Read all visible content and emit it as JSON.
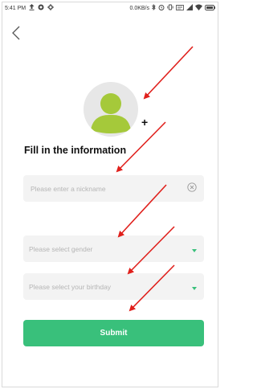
{
  "status_bar": {
    "time": "5:41 PM",
    "left_icons": [
      "upload-icon",
      "notification-icon",
      "settings-icon"
    ],
    "network_speed": "0.0KB/s",
    "right_icons": [
      "bluetooth-icon",
      "alarm-icon",
      "vibrate-icon",
      "volte-icon",
      "signal-icon",
      "wifi-icon",
      "battery-icon"
    ]
  },
  "header": {
    "back_icon": "chevron-left-icon"
  },
  "avatar": {
    "add_symbol": "+"
  },
  "form": {
    "title": "Fill in the information",
    "nickname": {
      "placeholder": "Please enter a nickname",
      "value": ""
    },
    "gender": {
      "placeholder": "Please select gender"
    },
    "birthday": {
      "placeholder": "Please select your birthday"
    },
    "submit_label": "Submit"
  },
  "colors": {
    "accent": "#39c07b",
    "avatar_figure": "#a5c93a",
    "annotation_arrow": "#e0201c"
  }
}
